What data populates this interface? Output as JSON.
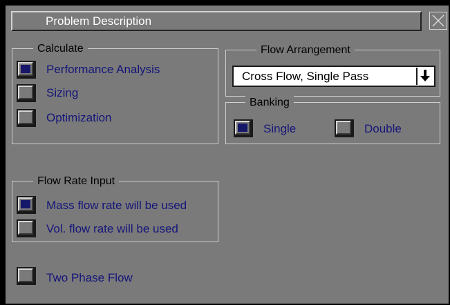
{
  "dialog": {
    "title": "Problem Description",
    "close_icon": "close-x-icon"
  },
  "calculate": {
    "legend": "Calculate",
    "options": [
      {
        "label": "Performance Analysis",
        "checked": true
      },
      {
        "label": "Sizing",
        "checked": false
      },
      {
        "label": "Optimization",
        "checked": false
      }
    ]
  },
  "flow_arrangement": {
    "legend": "Flow Arrangement",
    "selected": "Cross Flow, Single Pass",
    "dropdown_icon": "arrow-down-icon"
  },
  "banking": {
    "legend": "Banking",
    "options": [
      {
        "label": "Single",
        "checked": true
      },
      {
        "label": "Double",
        "checked": false
      }
    ]
  },
  "flow_rate_input": {
    "legend": "Flow Rate Input",
    "options": [
      {
        "label": "Mass flow rate will be used",
        "checked": true
      },
      {
        "label": "Vol. flow rate will be used",
        "checked": false
      }
    ]
  },
  "two_phase": {
    "label": "Two Phase Flow",
    "checked": false
  },
  "colors": {
    "panel": "#7a7a7a",
    "selected_fill": "#17176a",
    "label_text": "#15157a"
  }
}
